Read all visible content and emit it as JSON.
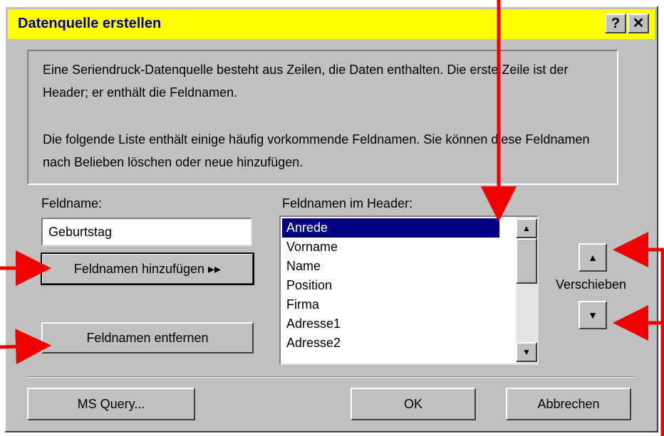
{
  "dialog": {
    "title": "Datenquelle erstellen",
    "help_icon": "?",
    "close_icon": "✕",
    "title_bar_color": "#ffff00"
  },
  "info": {
    "paragraph1": "Eine Seriendruck-Datenquelle besteht aus Zeilen, die Daten enthalten. Die erste Zeile ist der Header; er enthält die Feldnamen.",
    "paragraph2": "Die folgende Liste enthält einige häufig vorkommende Feldnamen. Sie können diese Feldnamen nach Belieben löschen oder neue hinzufügen."
  },
  "fieldname": {
    "label": "Feldname:",
    "value": "Geburtstag"
  },
  "buttons": {
    "add": "Feldnamen hinzufügen  ▸▸",
    "remove": "Feldnamen entfernen",
    "ms_query": "MS Query...",
    "ok": "OK",
    "cancel": "Abbrechen"
  },
  "header_list": {
    "label": "Feldnamen im Header:",
    "items": [
      "Anrede",
      "Vorname",
      "Name",
      "Position",
      "Firma",
      "Adresse1",
      "Adresse2"
    ],
    "selected": "Anrede"
  },
  "move": {
    "label": "Verschieben",
    "up_icon": "up-arrow-icon",
    "down_icon": "down-arrow-icon"
  },
  "annotation_color": "#ee0000"
}
